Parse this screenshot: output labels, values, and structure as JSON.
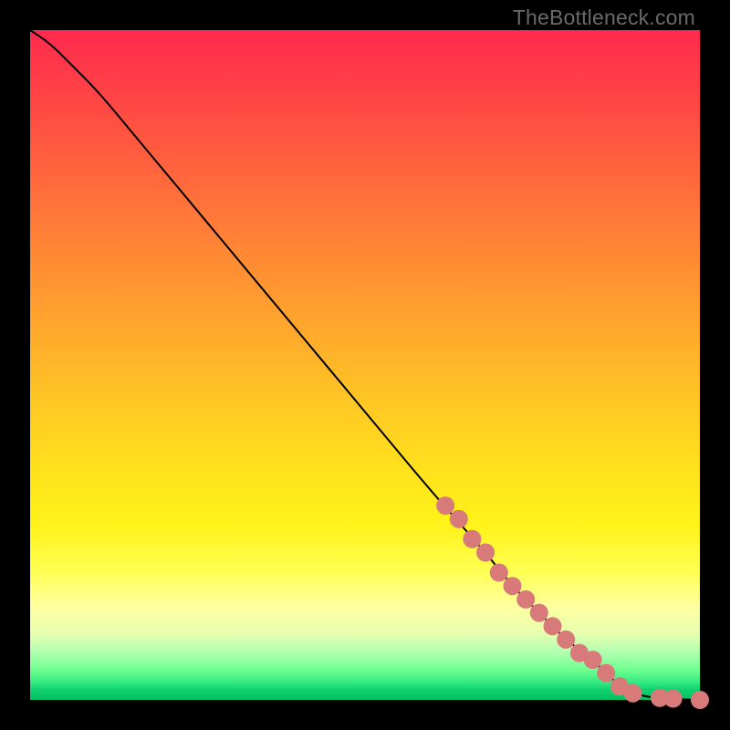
{
  "attribution": "TheBottleneck.com",
  "colors": {
    "dot": "#d87a7a",
    "line": "#000000",
    "gradient_top": "#ff2a4d",
    "gradient_bottom": "#00c060"
  },
  "chart_data": {
    "type": "line",
    "title": "",
    "xlabel": "",
    "ylabel": "",
    "xlim": [
      0,
      100
    ],
    "ylim": [
      0,
      100
    ],
    "grid": false,
    "series": [
      {
        "name": "curve",
        "x": [
          0,
          3,
          6,
          10,
          15,
          20,
          30,
          40,
          50,
          60,
          68,
          72,
          76,
          80,
          84,
          88,
          90,
          92,
          94,
          96,
          98,
          100
        ],
        "y": [
          100,
          98,
          95,
          91,
          85,
          79,
          67,
          55,
          43,
          31,
          22,
          17,
          13,
          9,
          6,
          2,
          1,
          0.5,
          0.2,
          0.1,
          0.05,
          0
        ]
      }
    ],
    "highlighted_points": [
      {
        "x": 62,
        "y": 29
      },
      {
        "x": 64,
        "y": 27
      },
      {
        "x": 66,
        "y": 24
      },
      {
        "x": 68,
        "y": 22
      },
      {
        "x": 70,
        "y": 19
      },
      {
        "x": 72,
        "y": 17
      },
      {
        "x": 74,
        "y": 15
      },
      {
        "x": 76,
        "y": 13
      },
      {
        "x": 78,
        "y": 11
      },
      {
        "x": 80,
        "y": 9
      },
      {
        "x": 82,
        "y": 7
      },
      {
        "x": 84,
        "y": 6
      },
      {
        "x": 86,
        "y": 4
      },
      {
        "x": 88,
        "y": 2
      },
      {
        "x": 90,
        "y": 1
      },
      {
        "x": 94,
        "y": 0.3
      },
      {
        "x": 96,
        "y": 0.2
      },
      {
        "x": 100,
        "y": 0
      }
    ]
  }
}
